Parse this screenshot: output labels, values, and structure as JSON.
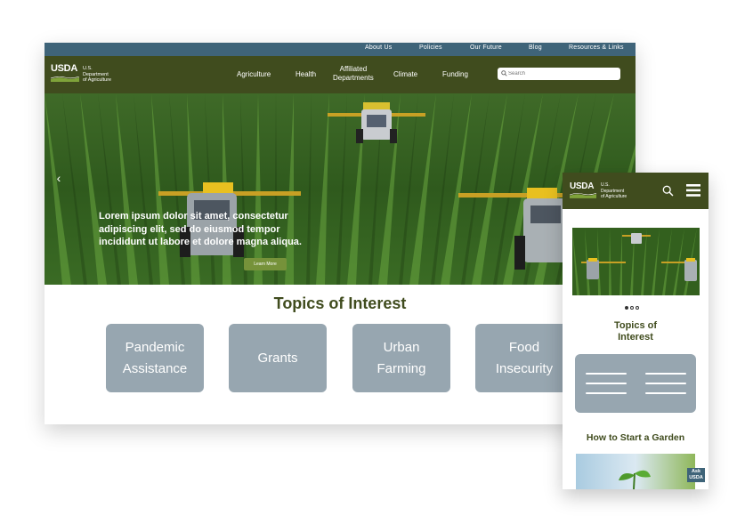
{
  "desktop": {
    "utility_links": [
      "About Us",
      "Policies",
      "Our Future",
      "Blog",
      "Resources & Links"
    ],
    "logo": {
      "mark": "USDA",
      "line1": "U.S.",
      "line2": "Department",
      "line3": "of Agriculture"
    },
    "nav": {
      "agriculture": "Agriculture",
      "health": "Health",
      "affiliated_1": "Affiliated",
      "affiliated_2": "Departments",
      "climate": "Climate",
      "funding": "Funding"
    },
    "search": {
      "placeholder": "Search",
      "icon": "search-icon"
    },
    "hero": {
      "caption": "Lorem ipsum dolor sit amet, consectetur adipiscing elit, sed do eiusmod tempor incididunt ut labore et dolore magna aliqua.",
      "button": "Learn More",
      "prev_icon": "chevron-left-icon"
    },
    "topics_title": "Topics of Interest",
    "topics": [
      {
        "line1": "Pandemic",
        "line2": "Assistance"
      },
      {
        "line1": "Grants",
        "line2": ""
      },
      {
        "line1": "Urban",
        "line2": "Farming"
      },
      {
        "line1": "Food",
        "line2": "Insecurity"
      }
    ]
  },
  "mobile": {
    "logo": {
      "mark": "USDA",
      "line1": "U.S.",
      "line2": "Department",
      "line3": "of Agriculture"
    },
    "search_icon": "search-icon",
    "menu_icon": "hamburger-menu-icon",
    "carousel_dots": {
      "count": 3,
      "active": 1
    },
    "topics_title_1": "Topics of",
    "topics_title_2": "Interest",
    "garden_title": "How to Start a Garden",
    "ask_1": "Ask",
    "ask_2": "USDA"
  },
  "colors": {
    "nav_green": "#404c1e",
    "utility_blue": "#3f6479",
    "tile_gray": "#97a6b0",
    "button_green": "#76923a"
  }
}
